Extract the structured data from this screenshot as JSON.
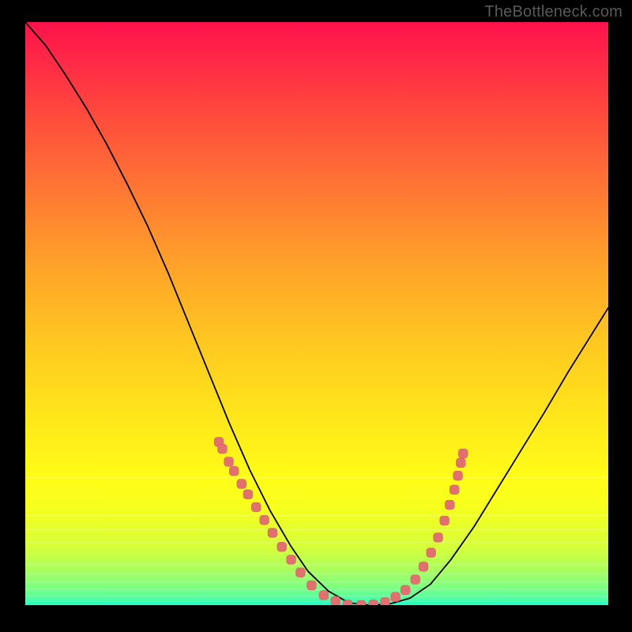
{
  "watermark": "TheBottleneck.com",
  "colors": {
    "background": "#000000",
    "watermark_text": "#595959",
    "curve": "#000000",
    "marker_fill": "#e27070",
    "marker_stroke": "#c95858",
    "gradient_top": "#ff124b",
    "gradient_bottom": "#1dffcb"
  },
  "chart_data": {
    "type": "line",
    "title": "",
    "xlabel": "",
    "ylabel": "",
    "xlim": [
      0,
      1
    ],
    "ylim": [
      0,
      1
    ],
    "legend": false,
    "grid": false,
    "annotations": [
      "TheBottleneck.com"
    ],
    "series": [
      {
        "name": "bottleneck-curve",
        "x": [
          0.0,
          0.035,
          0.07,
          0.105,
          0.14,
          0.175,
          0.21,
          0.245,
          0.28,
          0.315,
          0.35,
          0.385,
          0.42,
          0.455,
          0.485,
          0.52,
          0.555,
          0.59,
          0.625,
          0.66,
          0.695,
          0.73,
          0.77,
          0.81,
          0.85,
          0.89,
          0.93,
          0.965,
          1.0
        ],
        "y": [
          1.0,
          0.96,
          0.908,
          0.852,
          0.79,
          0.722,
          0.65,
          0.57,
          0.484,
          0.398,
          0.312,
          0.232,
          0.162,
          0.102,
          0.058,
          0.024,
          0.004,
          0.0,
          0.002,
          0.012,
          0.036,
          0.078,
          0.135,
          0.2,
          0.265,
          0.33,
          0.398,
          0.454,
          0.51
        ],
        "stroke": "#000000"
      }
    ],
    "markers": {
      "name": "highlight-region",
      "color": "#e27070",
      "points": [
        {
          "x": 0.332,
          "y": 0.28
        },
        {
          "x": 0.338,
          "y": 0.268
        },
        {
          "x": 0.349,
          "y": 0.246
        },
        {
          "x": 0.358,
          "y": 0.23
        },
        {
          "x": 0.371,
          "y": 0.208
        },
        {
          "x": 0.382,
          "y": 0.19
        },
        {
          "x": 0.396,
          "y": 0.168
        },
        {
          "x": 0.41,
          "y": 0.146
        },
        {
          "x": 0.424,
          "y": 0.124
        },
        {
          "x": 0.44,
          "y": 0.1
        },
        {
          "x": 0.456,
          "y": 0.078
        },
        {
          "x": 0.472,
          "y": 0.056
        },
        {
          "x": 0.491,
          "y": 0.034
        },
        {
          "x": 0.512,
          "y": 0.017
        },
        {
          "x": 0.532,
          "y": 0.007
        },
        {
          "x": 0.553,
          "y": 0.001
        },
        {
          "x": 0.576,
          "y": 0.0
        },
        {
          "x": 0.597,
          "y": 0.001
        },
        {
          "x": 0.617,
          "y": 0.005
        },
        {
          "x": 0.635,
          "y": 0.014
        },
        {
          "x": 0.652,
          "y": 0.026
        },
        {
          "x": 0.669,
          "y": 0.044
        },
        {
          "x": 0.683,
          "y": 0.066
        },
        {
          "x": 0.696,
          "y": 0.09
        },
        {
          "x": 0.708,
          "y": 0.116
        },
        {
          "x": 0.719,
          "y": 0.145
        },
        {
          "x": 0.728,
          "y": 0.172
        },
        {
          "x": 0.736,
          "y": 0.198
        },
        {
          "x": 0.742,
          "y": 0.222
        },
        {
          "x": 0.747,
          "y": 0.244
        },
        {
          "x": 0.751,
          "y": 0.26
        }
      ]
    }
  }
}
